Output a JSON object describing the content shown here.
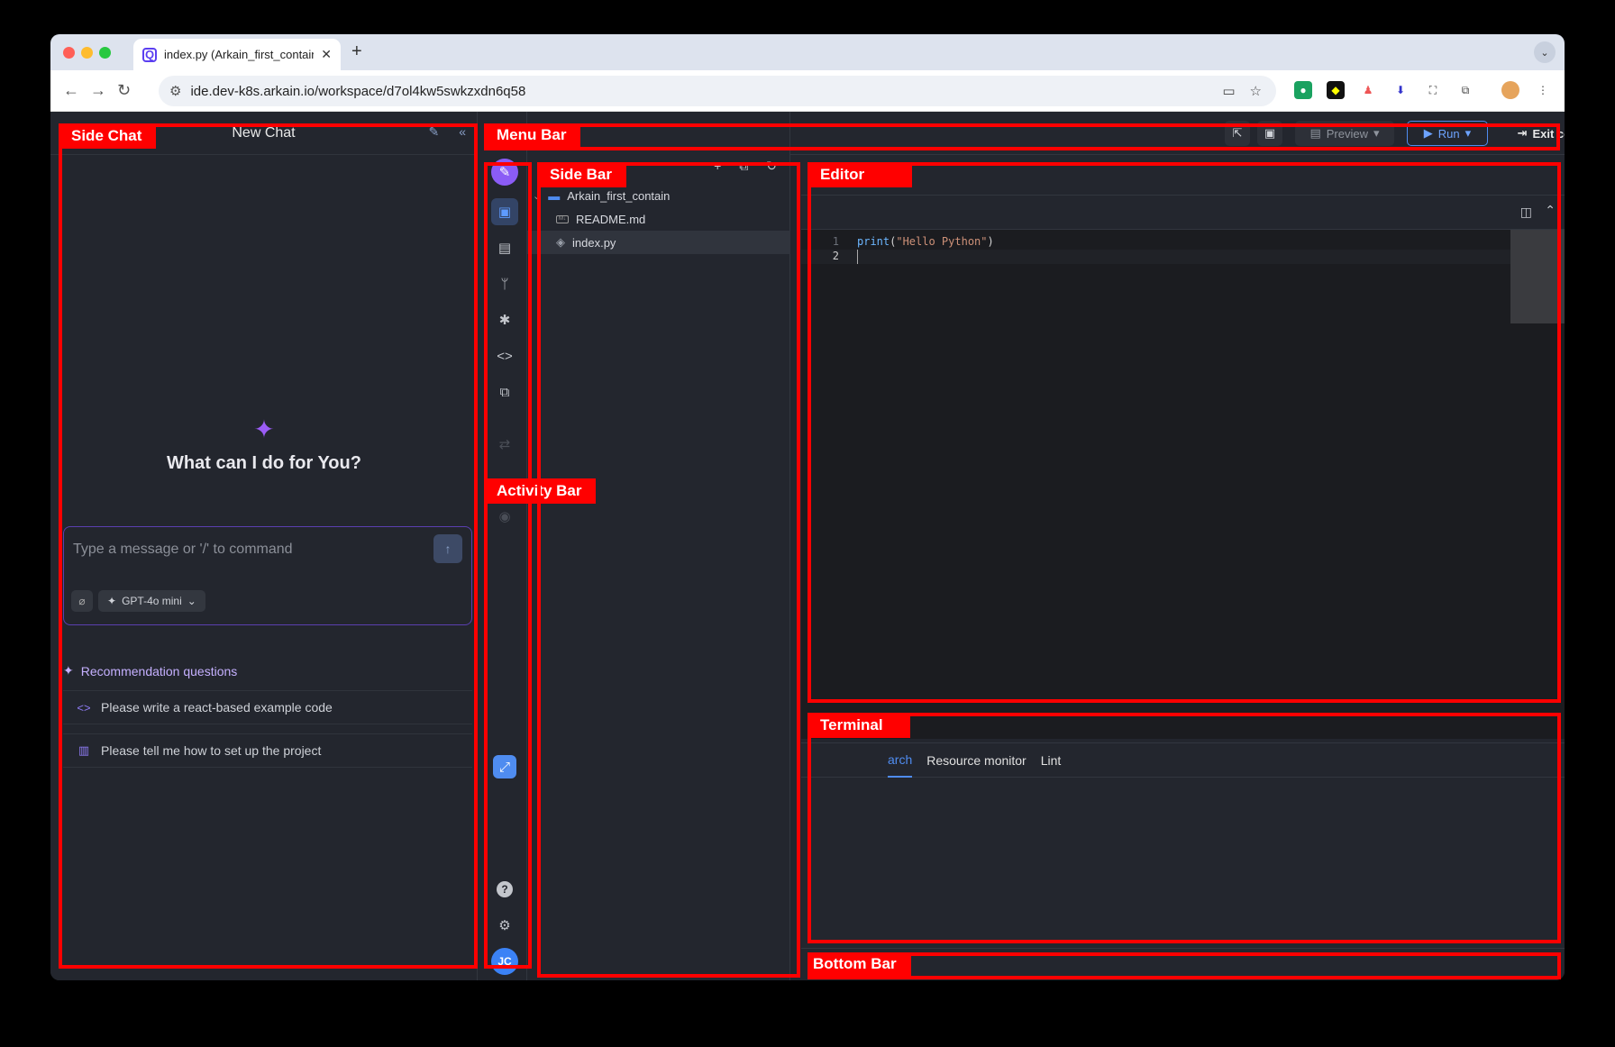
{
  "browser": {
    "tab_title": "index.py (Arkain_first_contain",
    "tab_close": "✕",
    "new_tab": "+",
    "url": "ide.dev-k8s.arkain.io/workspace/d7ol4kw5swkzxdn6q58",
    "favicon": "Q"
  },
  "side_chat": {
    "title": "New Chat",
    "greeting": "What can I do for You?",
    "input_placeholder": "Type a message or '/' to command",
    "model": "GPT-4o mini",
    "recommendation_title": "Recommendation questions",
    "recommendations": [
      {
        "icon": "code-icon",
        "text": "Please write a react-based example code"
      },
      {
        "icon": "book-icon",
        "text": "Please tell me how to set up the project"
      }
    ]
  },
  "menu_bar": {
    "preview_label": "Preview",
    "run_label": "Run",
    "exit_label": "Exit container"
  },
  "side_bar": {
    "project": "Arkain_first_contain",
    "files": [
      "README.md",
      "index.py"
    ]
  },
  "editor": {
    "lines": [
      {
        "number": "1",
        "fn": "print",
        "open": "(",
        "str": "\"Hello Python\"",
        "close": ")"
      },
      {
        "number": "2"
      }
    ]
  },
  "terminal": {
    "tabs": [
      "arch",
      "Resource monitor",
      "Lint"
    ],
    "active_tab": "arch"
  },
  "activity_bar": {
    "avatar_initials": "JC",
    "help": "?"
  },
  "annotations": {
    "side_chat": "Side Chat",
    "menu_bar": "Menu Bar",
    "side_bar": "Side Bar",
    "editor": "Editor",
    "activity_bar": "Activity Bar",
    "terminal": "Terminal",
    "bottom_bar": "Bottom Bar"
  },
  "colors": {
    "annotation": "#ff0000",
    "ide_bg": "#23262e",
    "accent": "#4f8cf0",
    "ai_purple": "#9b5cf6"
  }
}
